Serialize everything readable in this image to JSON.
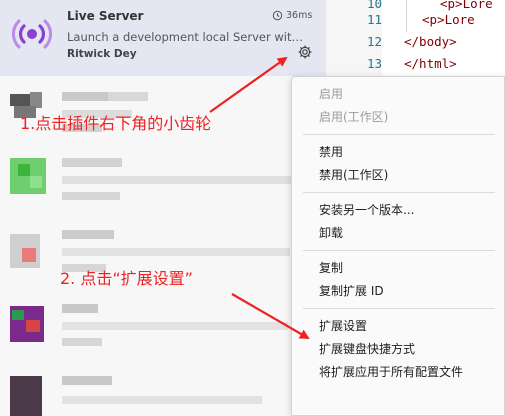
{
  "extension": {
    "name": "Live Server",
    "time": "36ms",
    "description": "Launch a development local Server with live reload feature for static & dynamic pages",
    "author": "Ritwick Dey",
    "colors": {
      "logo": "#8a3fd6",
      "selected_bg": "#e4e6f1"
    },
    "icons": [
      "broadcast-logo-icon",
      "history-clock-icon",
      "gear-icon"
    ]
  },
  "editor": {
    "lines": [
      {
        "num": "10",
        "code": "<p>Lore",
        "indent": 2
      },
      {
        "num": "11",
        "code": "<p>Lore",
        "indent": 1
      },
      {
        "num": "12",
        "code": "</body>",
        "indent": 0
      },
      {
        "num": "13",
        "code": "</html>",
        "indent": 0
      }
    ]
  },
  "menu": {
    "groups": [
      [
        {
          "label": "启用",
          "disabled": true
        },
        {
          "label": "启用(工作区)",
          "disabled": true
        }
      ],
      [
        {
          "label": "禁用",
          "disabled": false
        },
        {
          "label": "禁用(工作区)",
          "disabled": false
        }
      ],
      [
        {
          "label": "安装另一个版本...",
          "disabled": false
        },
        {
          "label": "卸载",
          "disabled": false
        }
      ],
      [
        {
          "label": "复制",
          "disabled": false
        },
        {
          "label": "复制扩展 ID",
          "disabled": false
        }
      ],
      [
        {
          "label": "扩展设置",
          "disabled": false
        },
        {
          "label": "扩展键盘快捷方式",
          "disabled": false
        },
        {
          "label": "将扩展应用于所有配置文件",
          "disabled": false
        }
      ]
    ]
  },
  "annotations": {
    "step1": "1.点击插件右下角的小齿轮",
    "step2": "2. 点击“扩展设置”",
    "color": "#ee2222"
  }
}
